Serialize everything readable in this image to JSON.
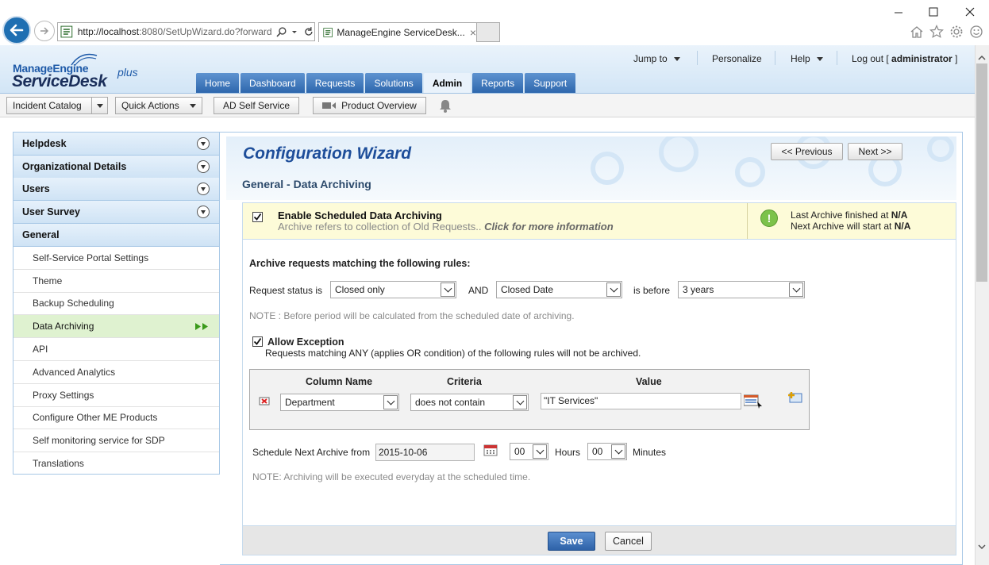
{
  "browser": {
    "address_host": "http://localhost",
    "address_rest": ":8080/SetUpWizard.do?forward",
    "tab_title": "ManageEngine ServiceDesk...",
    "tab_close": "×"
  },
  "app": {
    "logo_top": "ManageEngine",
    "logo_main": "ServiceDesk",
    "logo_plus": "plus",
    "top_links": {
      "jump_to": "Jump to",
      "personalize": "Personalize",
      "help": "Help",
      "logout_prefix": "Log out [ ",
      "logout_user": "administrator",
      "logout_suffix": " ]"
    },
    "nav_tabs": [
      "Home",
      "Dashboard",
      "Requests",
      "Solutions",
      "Admin",
      "Reports",
      "Support"
    ],
    "active_tab": "Admin"
  },
  "toolbar": {
    "incident_catalog": "Incident Catalog",
    "quick_actions": "Quick Actions",
    "ad_self_service": "AD Self Service",
    "product_overview": "Product Overview"
  },
  "sidebar": {
    "categories": [
      "Helpdesk",
      "Organizational Details",
      "Users",
      "User Survey",
      "General"
    ],
    "items": [
      "Self-Service Portal Settings",
      "Theme",
      "Backup Scheduling",
      "Data Archiving",
      "API",
      "Advanced Analytics",
      "Proxy Settings",
      "Configure Other ME Products",
      "Self monitoring service for SDP",
      "Translations"
    ],
    "active_item": "Data Archiving"
  },
  "wizard": {
    "title": "Configuration Wizard",
    "subtitle": "General - Data Archiving",
    "prev_btn": "<< Previous",
    "next_btn": "Next >>"
  },
  "archiving": {
    "enable_label": "Enable Scheduled Data Archiving",
    "enable_checked": true,
    "enable_desc": "Archive refers to collection of Old Requests..",
    "enable_link": "Click for more information",
    "last_finished_label": "Last Archive finished at ",
    "last_finished_value": "N/A",
    "next_start_label": "Next Archive will start at ",
    "next_start_value": "N/A",
    "rules_title": "Archive requests matching the following rules:",
    "request_status_label": "Request status is",
    "request_status_value": "Closed only",
    "and_label": "AND",
    "date_field_value": "Closed Date",
    "is_before_label": "is before",
    "period_value": "3 years",
    "period_note": "NOTE : Before period will be calculated from the scheduled date of archiving.",
    "allow_exception_label": "Allow Exception",
    "allow_exception_checked": true,
    "exception_desc": "Requests matching ANY (applies OR condition) of the following rules will not be archived.",
    "exception_headers": [
      "Column Name",
      "Criteria",
      "Value"
    ],
    "exception_rows": [
      {
        "column": "Department",
        "criteria": "does not contain",
        "value": "\"IT Services\""
      }
    ],
    "schedule_label": "Schedule Next Archive from",
    "schedule_date": "2015-10-06",
    "hours_value": "00",
    "hours_label": "Hours",
    "minutes_value": "00",
    "minutes_label": "Minutes",
    "schedule_note": "NOTE: Archiving will be executed everyday at the scheduled time.",
    "save_btn": "Save",
    "cancel_btn": "Cancel"
  },
  "colors": {
    "nav_tab": "#2e67ad",
    "title_blue": "#1e4e9a",
    "info_bar": "#fdfbd8",
    "active_item_bg": "#dff2d0",
    "save_btn": "#2e62a8"
  }
}
